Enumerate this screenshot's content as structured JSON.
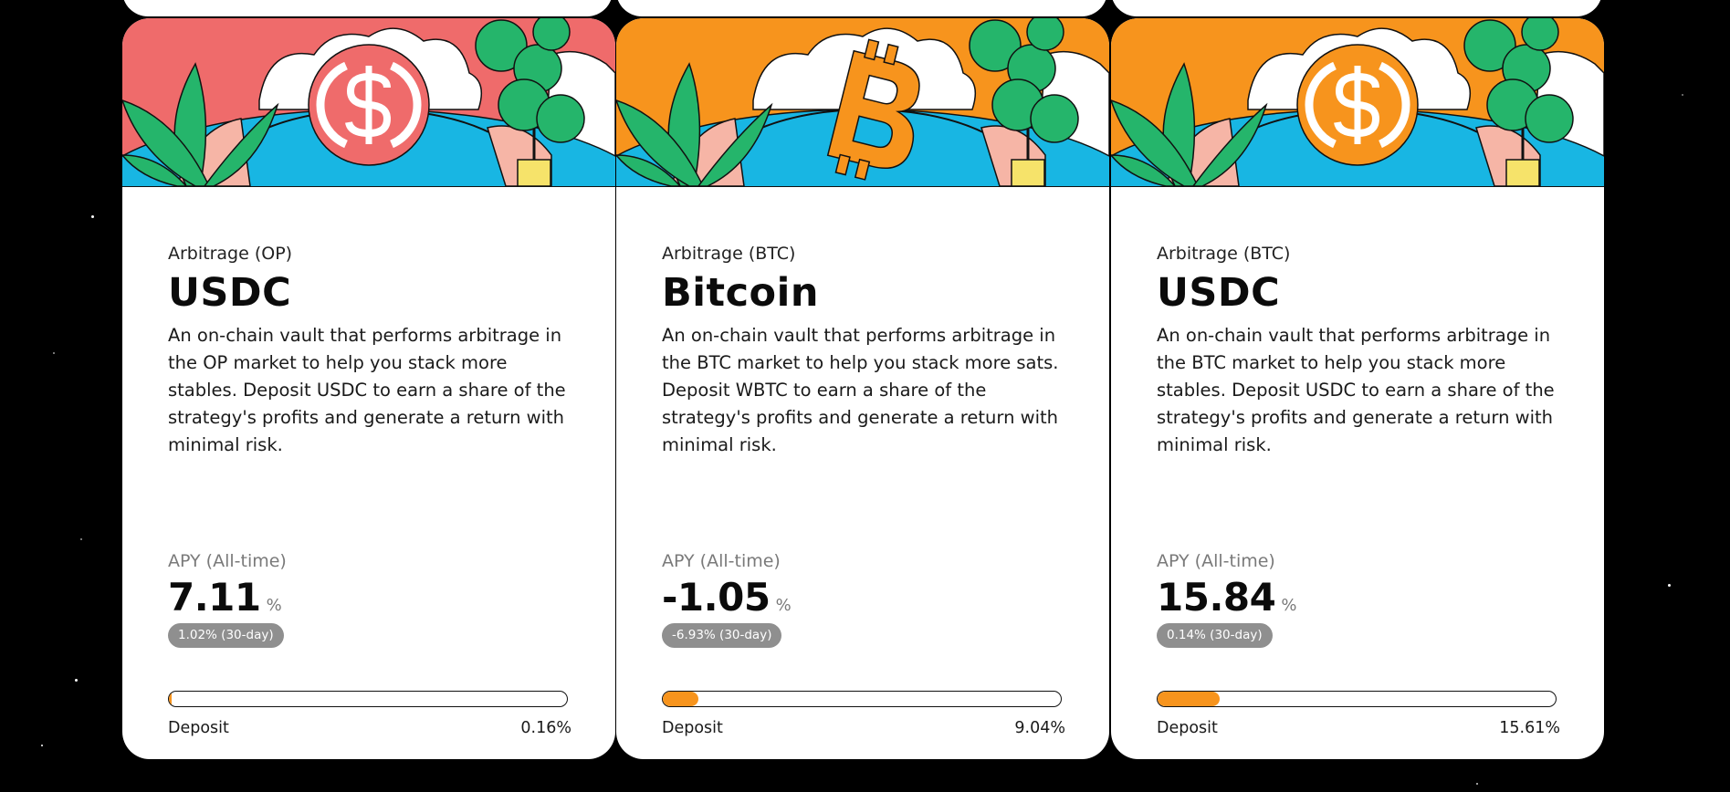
{
  "theme": {
    "usdc_red": "#ef6b6b",
    "btc_orange": "#f7941d",
    "pool_blue": "#18b6e3",
    "leaf_green": "#25b56b"
  },
  "vaults": [
    {
      "strategy": "Arbitrage (OP)",
      "asset": "USDC",
      "description": "An on-chain vault that performs arbitrage in the OP market to help you stack more stables. Deposit USDC to earn a share of the strategy's profits and generate a return with minimal risk.",
      "apy_label": "APY (All-time)",
      "apy_value": "7.11",
      "apy_unit": "%",
      "apy_30d": "1.02% (30-day)",
      "deposit_label": "Deposit",
      "deposit_value": "0.16%",
      "deposit_fraction": 0.0016,
      "hero_bg": "#ef6b6b",
      "hero_icon": "usdc-coin-icon"
    },
    {
      "strategy": "Arbitrage (BTC)",
      "asset": "Bitcoin",
      "description": "An on-chain vault that performs arbitrage in the BTC market to help you stack more sats. Deposit WBTC to earn a share of the strategy's profits and generate a return with minimal risk.",
      "apy_label": "APY (All-time)",
      "apy_value": "-1.05",
      "apy_unit": "%",
      "apy_30d": "-6.93% (30-day)",
      "deposit_label": "Deposit",
      "deposit_value": "9.04%",
      "deposit_fraction": 0.0904,
      "hero_bg": "#f7941d",
      "hero_icon": "bitcoin-icon"
    },
    {
      "strategy": "Arbitrage (BTC)",
      "asset": "USDC",
      "description": "An on-chain vault that performs arbitrage in the BTC market to help you stack more stables. Deposit USDC to earn a share of the strategy's profits and generate a return with minimal risk.",
      "apy_label": "APY (All-time)",
      "apy_value": "15.84",
      "apy_unit": "%",
      "apy_30d": "0.14% (30-day)",
      "deposit_label": "Deposit",
      "deposit_value": "15.61%",
      "deposit_fraction": 0.1561,
      "hero_bg": "#f7941d",
      "hero_icon": "usdc-coin-icon"
    }
  ]
}
